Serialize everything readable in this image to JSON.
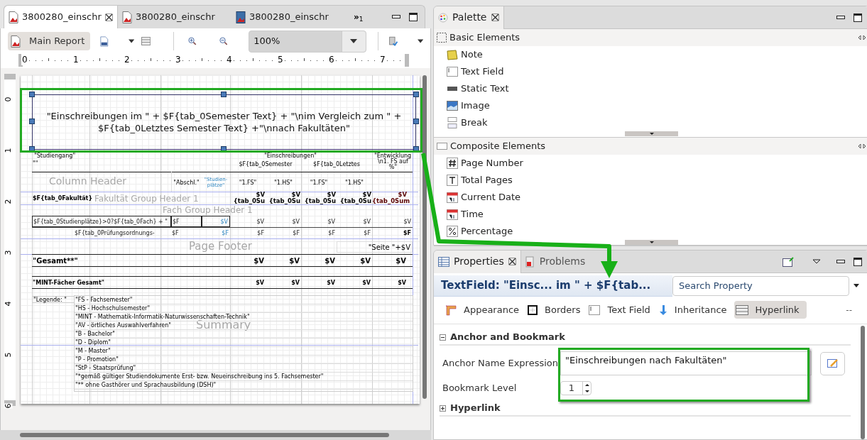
{
  "editor": {
    "tabs": [
      {
        "label": "3800280_einschr",
        "selected": true,
        "kind": "report"
      },
      {
        "label": "3800280_einschr",
        "selected": false,
        "kind": "report"
      },
      {
        "label": "3800280_einschr",
        "selected": false,
        "kind": "book"
      }
    ],
    "overflow": {
      "glyph": "»",
      "count": "1"
    },
    "toolbar": {
      "main_report": "Main Report",
      "zoom": "100%"
    },
    "ruler_h": [
      "0",
      "1",
      "2",
      "3",
      "4",
      "5",
      "6",
      "7"
    ],
    "ruler_v": [
      "0",
      "1",
      "2",
      "3",
      "4",
      "5",
      "6"
    ],
    "report": {
      "title_expression": "\"Einschreibungen im \" + $F{tab_0Semester Text} + \"\\nim Vergleich zum \" + $F{tab_0Letztes Semester Text} +\"\\nnach Fakultäten\"",
      "header_row_1": [
        "\"Studiengang\"",
        "\"Einschreibungen\"",
        "\"Entwicklung"
      ],
      "header_row_2": [
        "\"\"",
        "$F{tab_0Semester",
        "$F{tab_0Letztes",
        "\\n1. FS auf %\""
      ],
      "header_row_3": [
        "\"Abschl.\"",
        "\"Studien-plätze\"",
        "\"1.FS\"",
        "\"1.HS\"",
        "\"1.FS\"",
        "\"1.HS\""
      ],
      "faculty_row": [
        {
          "text": "$F{tab_0Fakultät}",
          "color": "#000000"
        },
        {
          "text": "$V {tab_0Su",
          "color": "#000000"
        },
        {
          "text": "$V {tab_0Su",
          "color": "#000000"
        },
        {
          "text": "$V {tab_0Su",
          "color": "#000000"
        },
        {
          "text": "$V {tab_0Su",
          "color": "#000000"
        },
        {
          "text": "$V {tab_0Sum",
          "color": "#5a0000"
        }
      ],
      "fach_row": [
        {
          "text": "$F{tab_0Studienplätze}>0?$F{tab_0Fach} + \"",
          "kind": "plain"
        },
        {
          "text": "$F",
          "kind": "plain"
        },
        {
          "text": "$V",
          "kind": "accent"
        },
        {
          "text": "$V",
          "kind": "plain"
        },
        {
          "text": "$V",
          "kind": "plain"
        },
        {
          "text": "$V",
          "kind": "plain"
        },
        {
          "text": "$V",
          "kind": "plain"
        },
        {
          "text": "$V",
          "kind": "plain"
        }
      ],
      "pruef_row": [
        {
          "text": "$F{tab_0Prüfungsordnungs-",
          "kind": "plain"
        },
        {
          "text": "$F",
          "kind": "plain"
        },
        {
          "text": "$F",
          "kind": "accent"
        },
        {
          "text": "$F",
          "kind": "plain"
        },
        {
          "text": "$F",
          "kind": "plain"
        },
        {
          "text": "$F",
          "kind": "plain"
        },
        {
          "text": "$F",
          "kind": "plain"
        },
        {
          "text": "$F",
          "kind": "bold"
        }
      ],
      "page_footer": "\"Seite \"+$V",
      "gesamt_row": [
        "\"Gesamt**\"",
        "$V",
        "$V",
        "$V",
        "$V",
        "$V"
      ],
      "mint_row": [
        "\"MINT-Fächer Gesamt\"",
        "$V",
        "$V",
        "$V",
        "$V",
        "$V"
      ],
      "legend_label": "\"Legende: \"",
      "legend": [
        "\"FS - Fachsemester\"",
        "\"HS - Hochschulsemester\"",
        "\"MINT - Mathematik-Informatik-Naturwissenschaften-Technik\"",
        "\"AV - örtliches Auswahlverfahren\"",
        "\"B - Bachelor\"",
        "\"D - Diplom\"",
        "\"M - Master\"",
        "\"P - Promotion\"",
        "\"StP - Staatsprüfung\"",
        "\"*gemäß gültiger Studiendokumente Erst- bzw. Neueinschreibung ins 5. Fachsemester\"",
        "\"** ohne Gasthörer und Sprachausbildung (DSH)\""
      ],
      "band_labels": [
        "Column Header",
        "Fakultät Group Header 1",
        "Fach Group Header 1",
        "Page Footer",
        "Summary"
      ]
    }
  },
  "palette": {
    "tab": "Palette",
    "groups": [
      {
        "title": "Basic Elements",
        "items": [
          {
            "label": "Note",
            "kind": "note"
          },
          {
            "label": "Text Field",
            "kind": "textfield"
          },
          {
            "label": "Static Text",
            "kind": "label"
          },
          {
            "label": "Image",
            "kind": "image"
          },
          {
            "label": "Break",
            "kind": "break"
          }
        ]
      },
      {
        "title": "Composite Elements",
        "items": [
          {
            "label": "Page Number",
            "kind": "hash"
          },
          {
            "label": "Total Pages",
            "kind": "total"
          },
          {
            "label": "Current Date",
            "kind": "calendar"
          },
          {
            "label": "Time",
            "kind": "calendar"
          },
          {
            "label": "Percentage",
            "kind": "percent"
          }
        ]
      }
    ]
  },
  "properties": {
    "tabs": [
      {
        "label": "Properties",
        "selected": true
      },
      {
        "label": "Problems",
        "selected": false
      }
    ],
    "heading": "TextField: \"Einsc... im \" + $F{tab...",
    "search": {
      "placeholder": "Search Property"
    },
    "sections": [
      {
        "label": "Appearance",
        "selected": false,
        "kind": "appearance"
      },
      {
        "label": "Borders",
        "selected": false,
        "kind": "borders"
      },
      {
        "label": "Text Field",
        "selected": false,
        "kind": "textfield"
      },
      {
        "label": "Inheritance",
        "selected": false,
        "kind": "inheritance"
      },
      {
        "label": "Hyperlink",
        "selected": true,
        "kind": "hyperlink"
      }
    ],
    "more": "--",
    "groups": [
      {
        "title": "Anchor and Bookmark",
        "expanded": true
      },
      {
        "title": "Hyperlink",
        "expanded": false
      }
    ],
    "anchor_label": "Anchor Name Expression",
    "anchor_value": "\"Einschreibungen nach Fakultäten\"",
    "bookmark_label": "Bookmark Level",
    "bookmark_value": "1"
  }
}
